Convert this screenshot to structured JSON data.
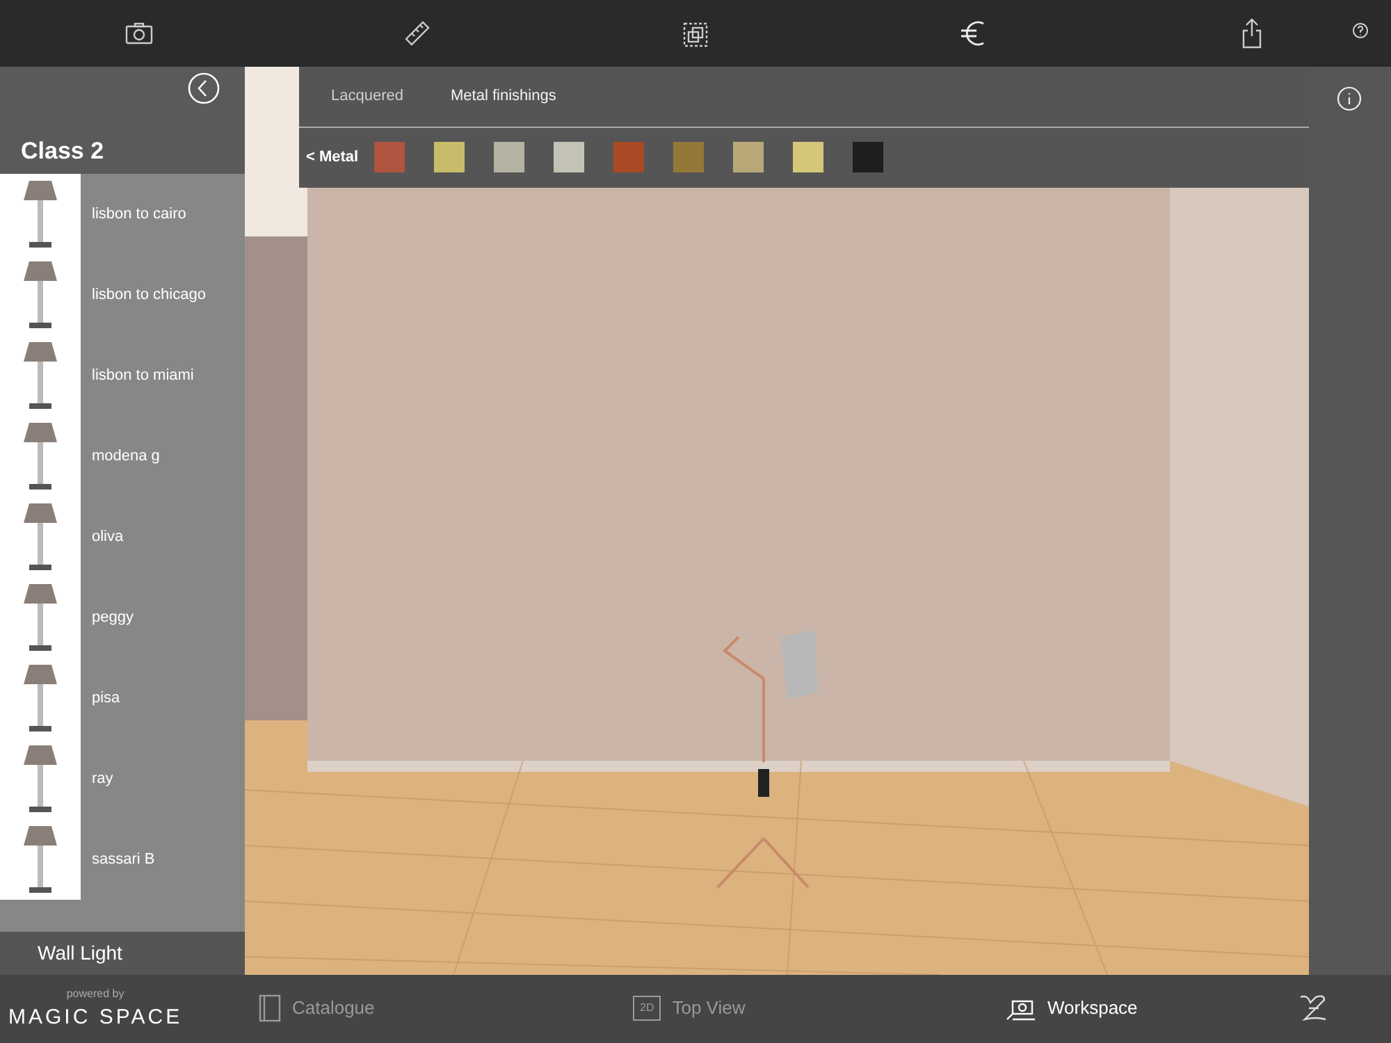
{
  "sidebar": {
    "title": "Class 2",
    "items": [
      {
        "label": "lisbon to cairo"
      },
      {
        "label": "lisbon to chicago"
      },
      {
        "label": "lisbon to miami"
      },
      {
        "label": "modena g"
      },
      {
        "label": "oliva"
      },
      {
        "label": "peggy"
      },
      {
        "label": "pisa"
      },
      {
        "label": "ray"
      },
      {
        "label": "sassari B"
      }
    ],
    "footer": "Wall Light"
  },
  "finish_panel": {
    "tabs": [
      {
        "label": "Lacquered",
        "selected": false
      },
      {
        "label": "Metal finishings",
        "selected": true
      }
    ],
    "back_label": "< Metal",
    "swatches": [
      {
        "color": "#b0553f"
      },
      {
        "color": "#c8bc6a"
      },
      {
        "color": "#b4b2a0"
      },
      {
        "color": "#c4c2b4"
      },
      {
        "color": "#a84a24"
      },
      {
        "color": "#94783a"
      },
      {
        "color": "#b8a878"
      },
      {
        "color": "#d4c878"
      },
      {
        "color": "#1e1e1e"
      }
    ]
  },
  "brand": {
    "powered_by": "powered by",
    "name": "MAGIC SPACE"
  },
  "bottom_nav": [
    {
      "label": "Catalogue",
      "selected": false,
      "kind": "catalogue"
    },
    {
      "label": "Top View",
      "selected": false,
      "kind": "topview",
      "badge": "2D"
    },
    {
      "label": "Workspace",
      "selected": true,
      "kind": "workspace"
    }
  ]
}
